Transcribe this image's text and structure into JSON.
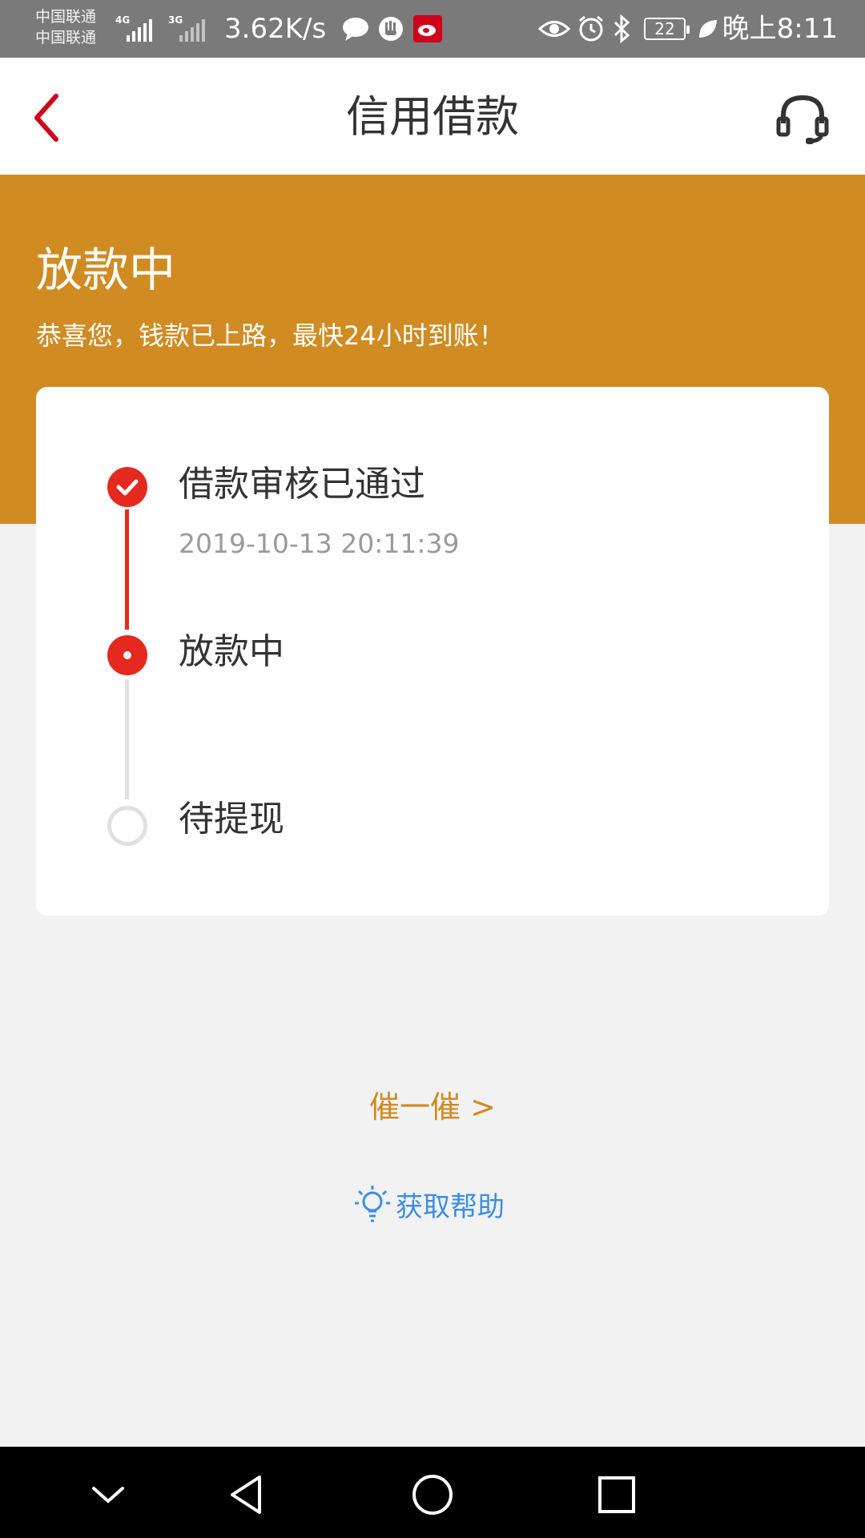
{
  "status_bar": {
    "carrier1": "中国联通",
    "carrier2": "中国联通",
    "network1": "4G",
    "network2": "3G",
    "net_speed": "3.62K/s",
    "battery": "22",
    "time": "晚上8:11",
    "icons": [
      "message-icon",
      "hand-icon",
      "weibo-icon",
      "eye-icon",
      "alarm-icon",
      "bluetooth-icon",
      "battery-icon",
      "leaf-icon"
    ]
  },
  "header": {
    "title": "信用借款",
    "back_icon": "chevron-left-icon",
    "support_icon": "headset-icon"
  },
  "hero": {
    "title": "放款中",
    "subtitle": "恭喜您，钱款已上路，最快24小时到账！",
    "color": "#d08b22"
  },
  "progress": {
    "steps": [
      {
        "label": "借款审核已通过",
        "time": "2019-10-13 20:11:39",
        "state": "done"
      },
      {
        "label": "放款中",
        "state": "current"
      },
      {
        "label": "待提现",
        "state": "pending"
      }
    ],
    "active_color": "#e5291e",
    "pending_color": "#e0e0e0"
  },
  "actions": {
    "urge": "催一催 >",
    "help": "获取帮助"
  },
  "system_nav": [
    "chevron-down-icon",
    "back-triangle-icon",
    "home-circle-icon",
    "recents-square-icon"
  ]
}
